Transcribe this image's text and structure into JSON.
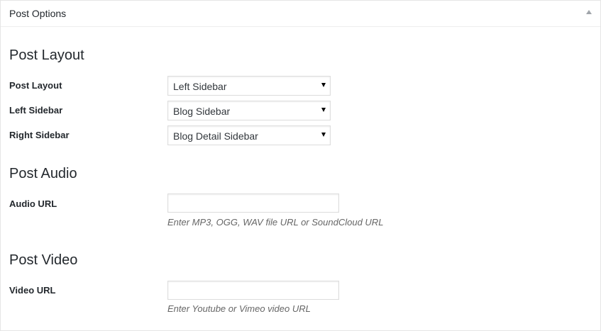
{
  "panel": {
    "title": "Post Options",
    "toggle_icon": "triangle-up-icon"
  },
  "sections": {
    "layout": {
      "heading": "Post Layout",
      "fields": [
        {
          "label": "Post Layout",
          "selected": "Left Sidebar"
        },
        {
          "label": "Left Sidebar",
          "selected": "Blog Sidebar"
        },
        {
          "label": "Right Sidebar",
          "selected": "Blog Detail Sidebar"
        }
      ]
    },
    "audio": {
      "heading": "Post Audio",
      "field_label": "Audio URL",
      "value": "",
      "description": "Enter MP3, OGG, WAV file URL or SoundCloud URL"
    },
    "video": {
      "heading": "Post Video",
      "field_label": "Video URL",
      "value": "",
      "description": "Enter Youtube or Vimeo video URL"
    }
  }
}
